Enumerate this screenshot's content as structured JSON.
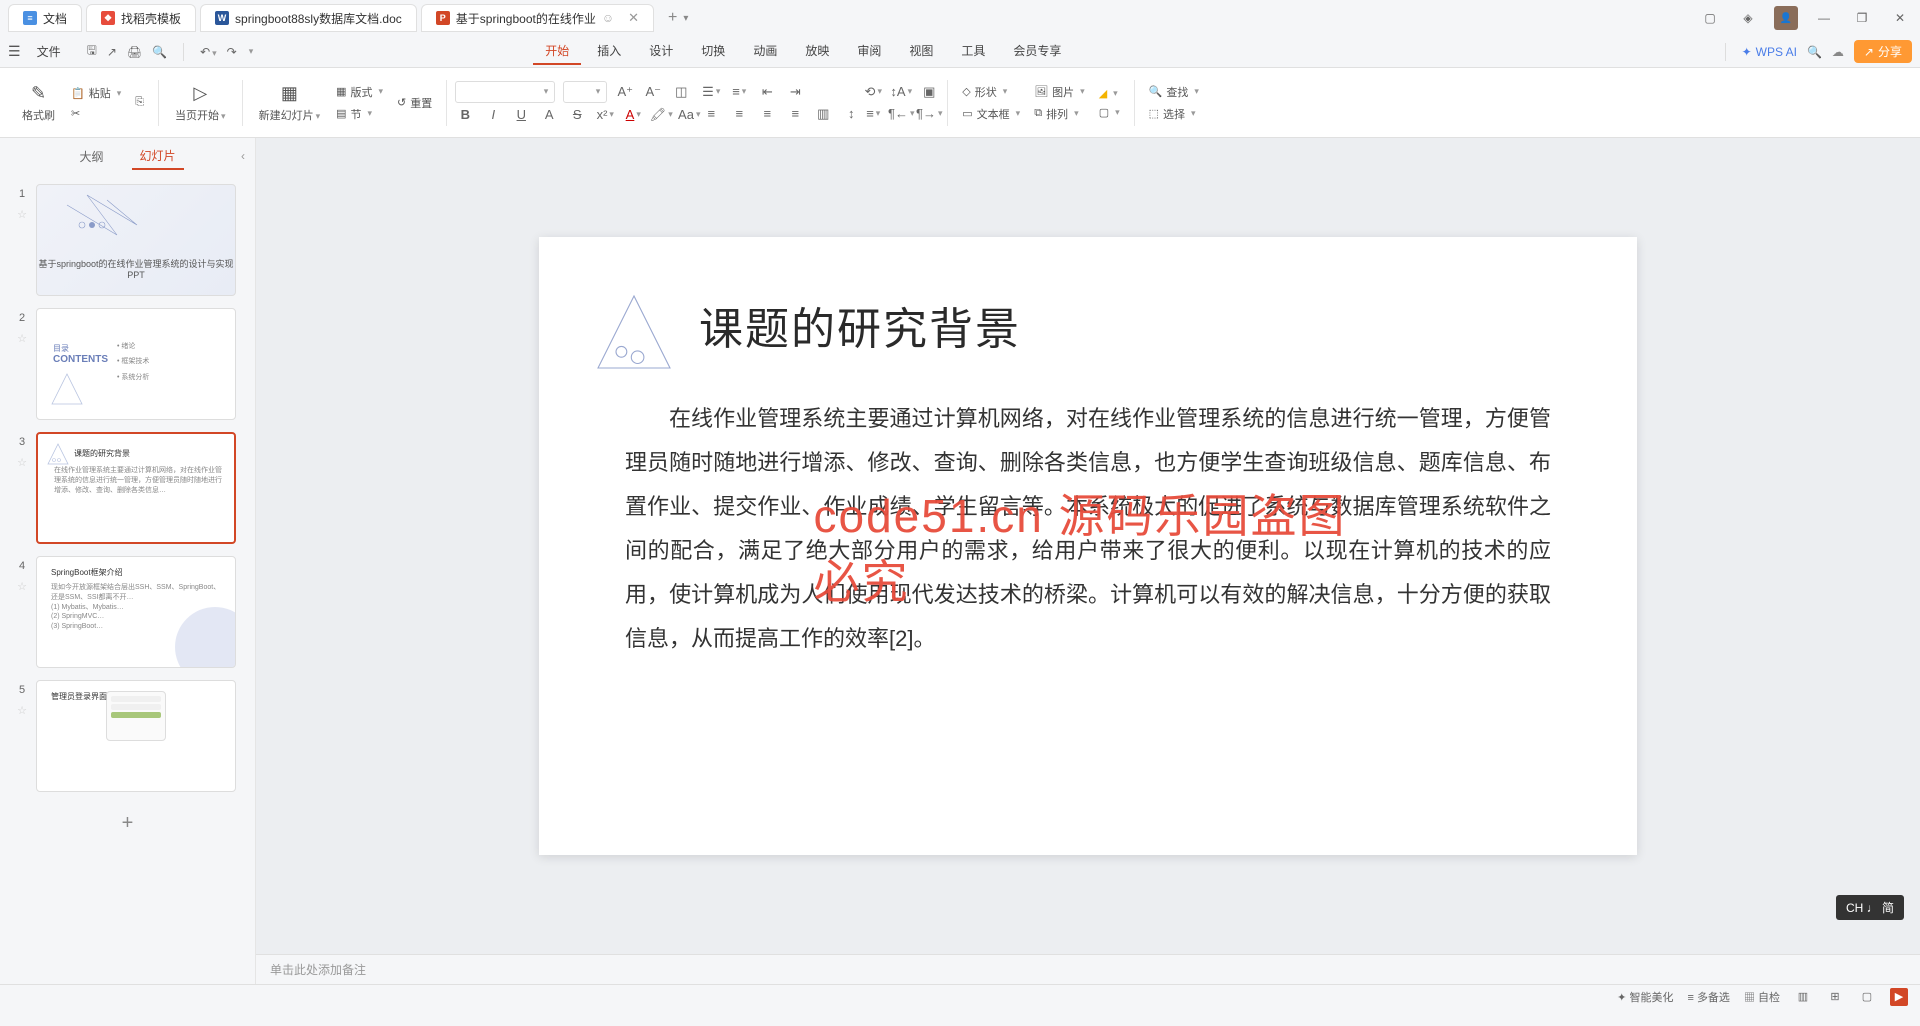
{
  "tabs": [
    {
      "icon": "doc",
      "label": "文档"
    },
    {
      "icon": "wps",
      "label": "找稻壳模板"
    },
    {
      "icon": "word",
      "label": "springboot88sly数据库文档.doc"
    },
    {
      "icon": "ppt",
      "label": "基于springboot的在线作业",
      "active": true
    }
  ],
  "menubar": {
    "file": "文件",
    "ai": "WPS AI",
    "share": "分享"
  },
  "ribbon_tabs": [
    "开始",
    "插入",
    "设计",
    "切换",
    "动画",
    "放映",
    "审阅",
    "视图",
    "工具",
    "会员专享"
  ],
  "ribbon_active": 0,
  "ribbon": {
    "format_painter": "格式刷",
    "paste": "粘贴",
    "start_from": "当页开始",
    "new_slide": "新建幻灯片",
    "layout": "版式",
    "section": "节",
    "reset": "重置",
    "shape": "形状",
    "image": "图片",
    "textbox": "文本框",
    "arrange": "排列",
    "find": "查找",
    "select": "选择"
  },
  "side_tabs": {
    "outline": "大纲",
    "slides": "幻灯片"
  },
  "slides": [
    {
      "num": "1",
      "title": "基于springboot的在线作业管理系统的设计与实现PPT"
    },
    {
      "num": "2",
      "title": "目录",
      "sub": "CONTENTS",
      "items": [
        "绪论",
        "框架技术",
        "系统分析"
      ]
    },
    {
      "num": "3",
      "title": "课题的研究背景",
      "selected": true
    },
    {
      "num": "4",
      "title": "SpringBoot框架介绍"
    },
    {
      "num": "5",
      "title": "管理员登录界面"
    }
  ],
  "current_slide": {
    "title": "课题的研究背景",
    "body": "在线作业管理系统主要通过计算机网络，对在线作业管理系统的信息进行统一管理，方便管理员随时随地进行增添、修改、查询、删除各类信息，也方便学生查询班级信息、题库信息、布置作业、提交作业、作业成绩、学生留言等。本系统极大的促进了系统与数据库管理系统软件之间的配合，满足了绝大部分用户的需求，给用户带来了很大的便利。以现在计算机的技术的应用，使计算机成为人们使用现代发达技术的桥梁。计算机可以有效的解决信息，十分方便的获取信息，从而提高工作的效率[2]。",
    "watermark": "code51.cn 源码乐园盗图必究"
  },
  "notes_placeholder": "单击此处添加备注",
  "statusbar": {
    "smart": "智能美化",
    "multi": "多备选",
    "fit": "自检",
    "play_single": "▷",
    "play": "▷"
  },
  "ime": "CH ♩ 简"
}
